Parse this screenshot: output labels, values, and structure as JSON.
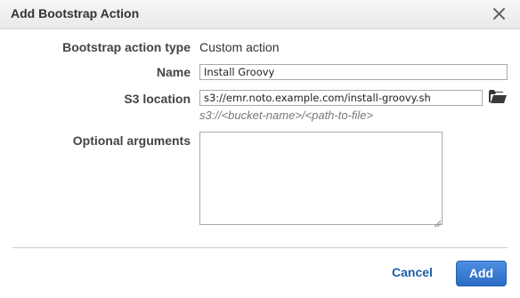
{
  "dialog": {
    "title": "Add Bootstrap Action",
    "close_icon": "close-icon"
  },
  "form": {
    "type_label": "Bootstrap action type",
    "type_value": "Custom action",
    "name_label": "Name",
    "name_value": "Install Groovy",
    "s3_label": "S3 location",
    "s3_value": "s3://emr.noto.example.com/install-groovy.sh",
    "s3_hint": "s3://<bucket-name>/<path-to-file>",
    "s3_browse_icon": "folder-open-icon",
    "args_label": "Optional arguments",
    "args_value": ""
  },
  "footer": {
    "cancel_label": "Cancel",
    "add_label": "Add"
  },
  "colors": {
    "accent": "#2a6cc4",
    "link": "#1b5fa8"
  }
}
